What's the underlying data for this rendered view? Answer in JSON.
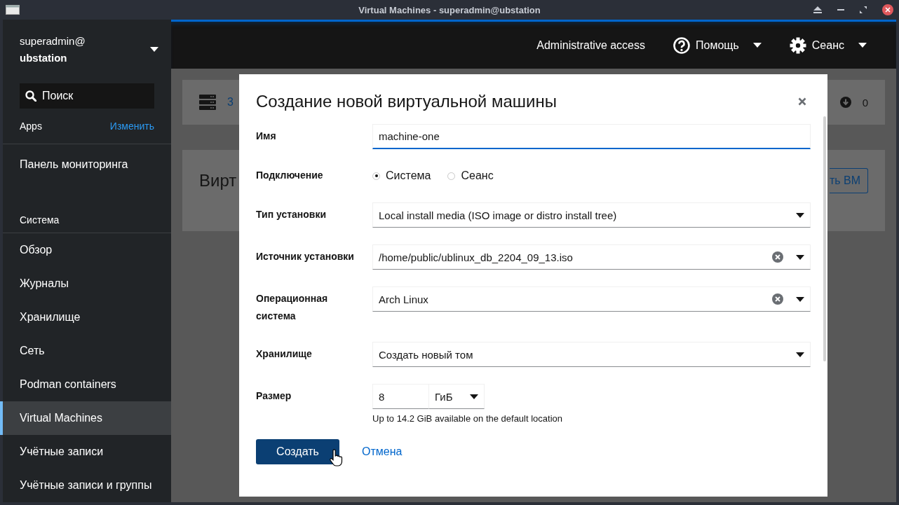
{
  "window": {
    "title": "Virtual Machines - superadmin@ubstation"
  },
  "sidebar": {
    "user": "superadmin@",
    "host": "ubstation",
    "search": {
      "placeholder": "Поиск"
    },
    "apps_label": "Apps",
    "edit_link": "Изменить",
    "top_items": [
      {
        "label": "Панель мониторинга",
        "selected": false
      }
    ],
    "sections": [
      {
        "title": "Система",
        "items": [
          {
            "label": "Обзор",
            "selected": false
          },
          {
            "label": "Журналы",
            "selected": false
          },
          {
            "label": "Хранилище",
            "selected": false
          },
          {
            "label": "Сеть",
            "selected": false
          },
          {
            "label": "Podman containers",
            "selected": false
          },
          {
            "label": "Virtual Machines",
            "selected": true
          },
          {
            "label": "Учётные записи",
            "selected": false
          },
          {
            "label": "Учётные записи и группы",
            "selected": false
          }
        ]
      }
    ]
  },
  "header": {
    "admin_access": "Administrative access",
    "help": "Помощь",
    "session": "Сеанс"
  },
  "background": {
    "card_link": "3",
    "count": "0",
    "heading": "Вирт",
    "button": "ть ВМ"
  },
  "dialog": {
    "title": "Создание новой виртуальной машины",
    "fields": [
      {
        "kind": "text",
        "label": "Имя",
        "value": "machine-one"
      },
      {
        "kind": "radio",
        "label": "Подключение",
        "options": [
          {
            "label": "Система",
            "selected": true
          },
          {
            "label": "Сеанс",
            "selected": false
          }
        ]
      },
      {
        "kind": "select",
        "label": "Тип установки",
        "value": "Local install media (ISO image or distro install tree)",
        "clearable": false
      },
      {
        "kind": "select",
        "label": "Источник установки",
        "value": "/home/public/ublinux_db_2204_09_13.iso",
        "clearable": true
      },
      {
        "kind": "select",
        "label": "Операционная система",
        "value": "Arch Linux",
        "clearable": true
      },
      {
        "kind": "select",
        "label": "Хранилище",
        "value": "Создать новый том",
        "clearable": false
      },
      {
        "kind": "size",
        "label": "Размер",
        "value": "8",
        "unit": "ГиБ",
        "helper": "Up to 14.2 GiB available on the default location"
      }
    ],
    "primary": "Создать",
    "cancel": "Отмена"
  }
}
